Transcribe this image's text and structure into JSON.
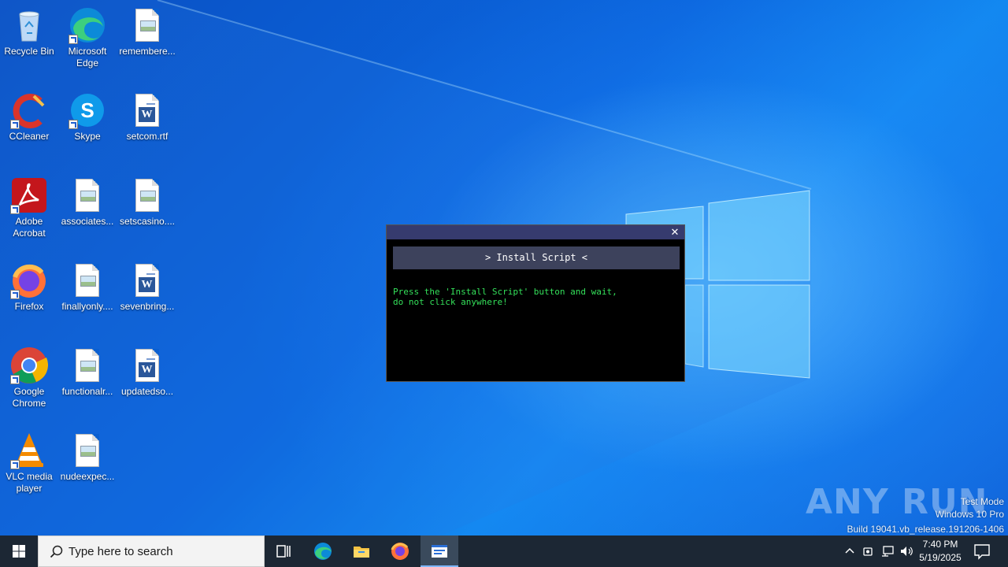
{
  "desktop": {
    "icons": [
      {
        "label": "Recycle Bin",
        "icon": "recycle-bin-icon"
      },
      {
        "label": "Microsoft Edge",
        "icon": "edge-icon"
      },
      {
        "label": "remembere...",
        "icon": "image-file-icon"
      },
      {
        "label": "CCleaner",
        "icon": "ccleaner-icon"
      },
      {
        "label": "Skype",
        "icon": "skype-icon"
      },
      {
        "label": "setcom.rtf",
        "icon": "word-file-icon"
      },
      {
        "label": "Adobe Acrobat",
        "icon": "acrobat-icon"
      },
      {
        "label": "associates...",
        "icon": "image-file-icon"
      },
      {
        "label": "setscasino....",
        "icon": "image-file-icon"
      },
      {
        "label": "Firefox",
        "icon": "firefox-icon"
      },
      {
        "label": "finallyonly....",
        "icon": "image-file-icon"
      },
      {
        "label": "sevenbring...",
        "icon": "word-file-icon"
      },
      {
        "label": "Google Chrome",
        "icon": "chrome-icon"
      },
      {
        "label": "functionalr...",
        "icon": "image-file-icon"
      },
      {
        "label": "updatedso...",
        "icon": "word-file-icon"
      },
      {
        "label": "VLC media player",
        "icon": "vlc-icon"
      },
      {
        "label": "nudeexpec...",
        "icon": "image-file-icon"
      }
    ]
  },
  "dialog": {
    "close_label": "✕",
    "install_button": "> Install Script <",
    "message_line1": "Press the 'Install Script' button and wait,",
    "message_line2": "do not click anywhere!"
  },
  "watermark": {
    "logo": "ANY RUN",
    "test_mode": "Test Mode",
    "edition": "Windows 10 Pro",
    "build": "Build 19041.vb_release.191206-1406"
  },
  "taskbar": {
    "search_placeholder": "Type here to search",
    "pinned": [
      "task-view-icon",
      "edge-icon",
      "file-explorer-icon",
      "firefox-icon",
      "app-window-icon"
    ],
    "time": "7:40 PM",
    "date": "5/19/2025"
  },
  "colors": {
    "dialog_titlebar": "#363b6e",
    "dialog_button": "#3d425c",
    "terminal_green": "#34e05a",
    "taskbar": "#1c2734"
  }
}
